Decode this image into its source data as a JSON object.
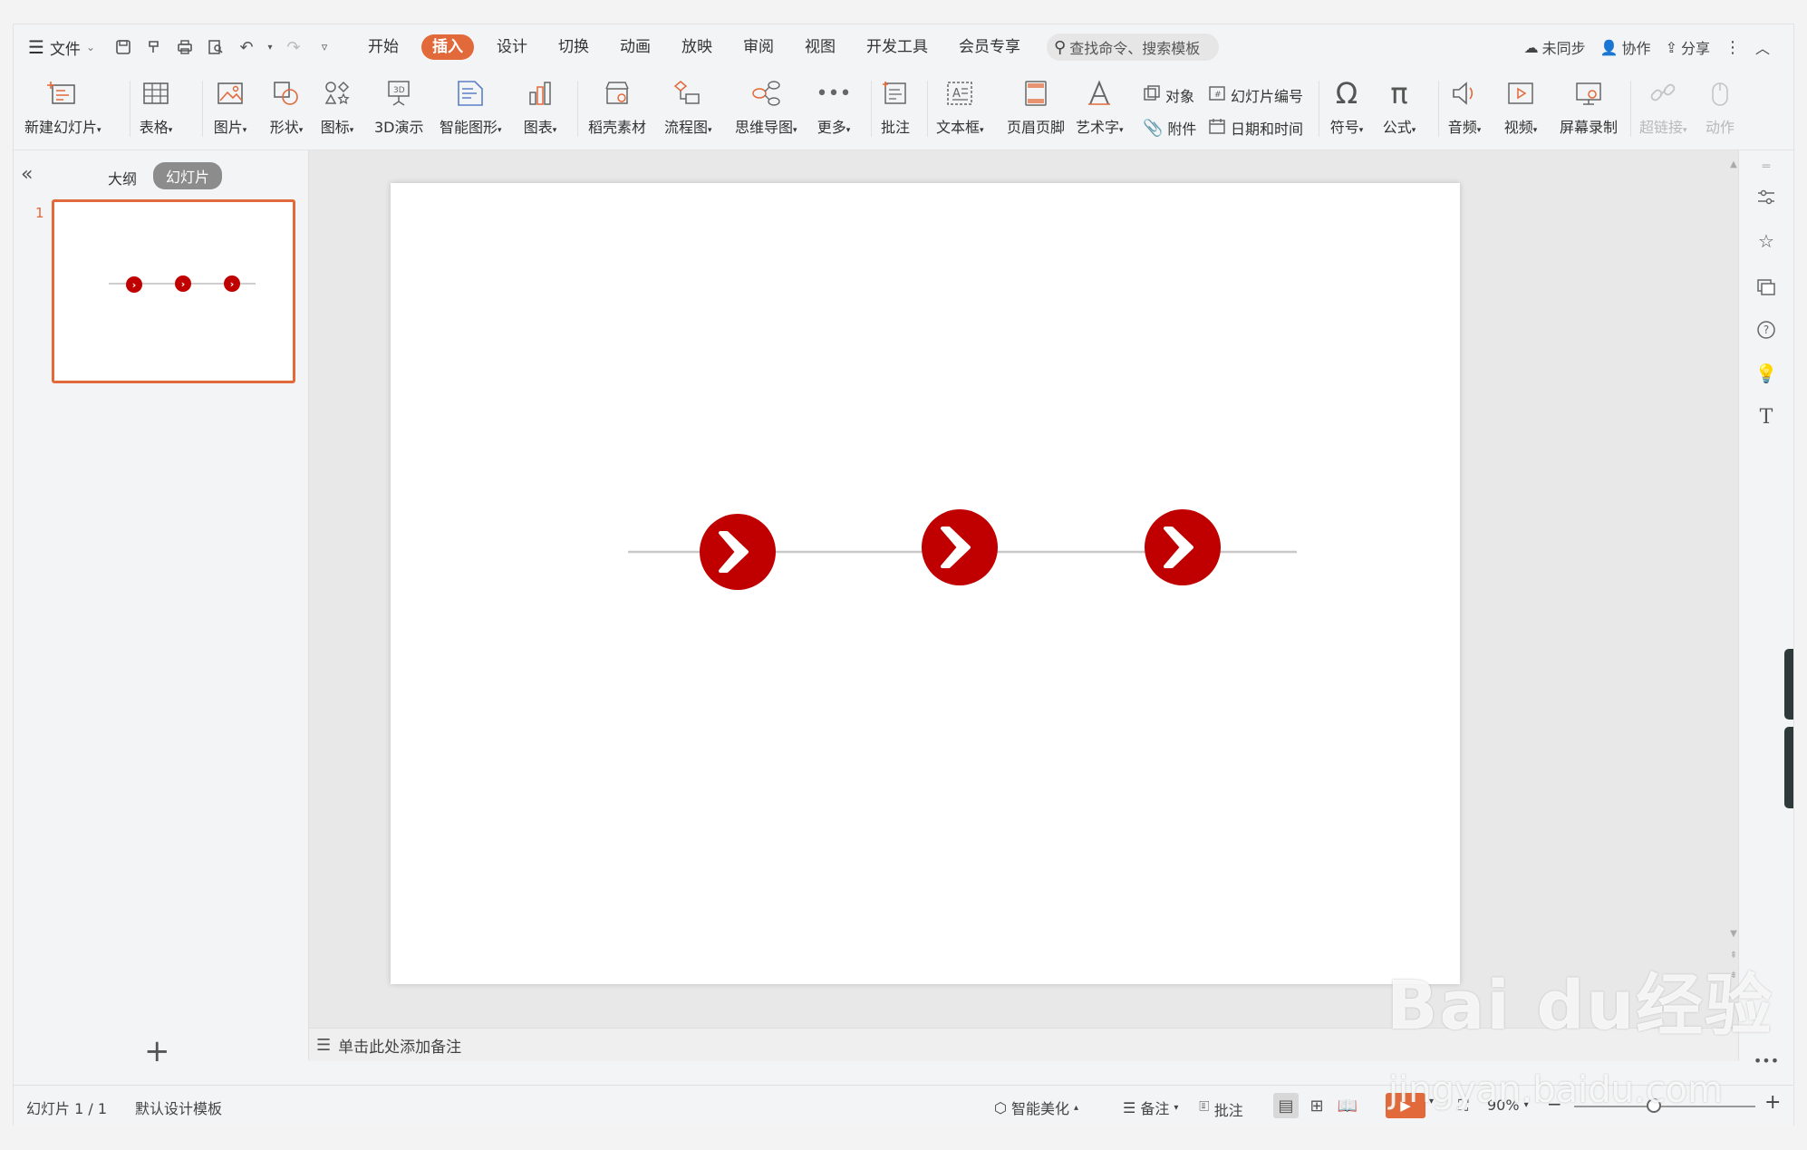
{
  "menu": {
    "file_label": "文件"
  },
  "tabs": [
    {
      "label": "开始"
    },
    {
      "label": "插入",
      "active": true
    },
    {
      "label": "设计"
    },
    {
      "label": "切换"
    },
    {
      "label": "动画"
    },
    {
      "label": "放映"
    },
    {
      "label": "审阅"
    },
    {
      "label": "视图"
    },
    {
      "label": "开发工具"
    },
    {
      "label": "会员专享"
    }
  ],
  "search": {
    "placeholder": "查找命令、搜索模板"
  },
  "topright": {
    "sync": "未同步",
    "collab": "协作",
    "share": "分享"
  },
  "ribbon": {
    "new_slide": "新建幻灯片",
    "table": "表格",
    "picture": "图片",
    "shape": "形状",
    "icon": "图标",
    "demo3d": "3D演示",
    "smartart": "智能图形",
    "chart": "图表",
    "stock": "稻壳素材",
    "flow": "流程图",
    "mindmap": "思维导图",
    "more": "更多",
    "comment": "批注",
    "textbox": "文本框",
    "header_footer": "页眉页脚",
    "wordart": "艺术字",
    "object": "对象",
    "slide_number": "幻灯片编号",
    "attachment": "附件",
    "datetime": "日期和时间",
    "symbol": "符号",
    "formula": "公式",
    "audio": "音频",
    "video": "视频",
    "screen_record": "屏幕录制",
    "hyperlink": "超链接",
    "action": "动作"
  },
  "left_panel": {
    "outline_tab": "大纲",
    "slides_tab": "幻灯片",
    "slide_number": "1"
  },
  "notes": {
    "placeholder": "单击此处添加备注"
  },
  "status": {
    "slide_count": "幻灯片 1 / 1",
    "template": "默认设计模板",
    "beautify": "智能美化",
    "notes": "备注",
    "comment": "批注",
    "zoom": "90%"
  },
  "slide": {
    "line_color": "#c8c8c8",
    "circle_color": "#c00000",
    "arrow_glyph": "❯"
  },
  "watermark": {
    "brand": "Bai du经验",
    "url": "jingyan.baidu.com"
  },
  "colors": {
    "accent": "#e2693a"
  }
}
